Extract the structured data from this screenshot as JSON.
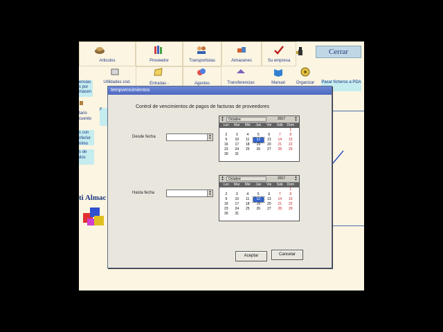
{
  "app": {
    "cerrar_label": "Cerrar",
    "top_row": [
      "Articulos",
      "Proveedor",
      "Transportistas",
      "Almacenes",
      "Su empresa"
    ],
    "second_row": [
      "Utilidades cod.",
      "Entradas -",
      "Agentes",
      "Transferencias",
      "Manual",
      "Organizar",
      "Pasar ficheros a PDA"
    ],
    "left_fragments": [
      "encias",
      "s por",
      "macen",
      "tario",
      "cuento",
      "s con",
      "nferior",
      "nimo",
      "s de",
      "dos"
    ],
    "small_fragment": "F",
    "brand_fragment": "ti Almac",
    "right_fragment": "a",
    "colors": {
      "background": "#fbf5e2",
      "cyan": "#c5ecef",
      "label": "#203a8a"
    }
  },
  "dialog": {
    "title": "tempvencimientos",
    "heading": "Control de vencimientos de pagos de facturas de proveedores",
    "desde_label": "Desde fecha",
    "hasta_label": "Hasta fecha",
    "accept_label": "Aceptar",
    "cancel_label": "Cancelar",
    "calendar_desde": {
      "month": "Octubre",
      "year": "2017",
      "weekdays": [
        "Lun",
        "Mar",
        "Mié",
        "Jue",
        "Vie",
        "Sáb",
        "Dom"
      ],
      "selected_day": 12,
      "first_weekday_index": 6,
      "days_in_month": 31
    },
    "calendar_hasta": {
      "month": "Octubre",
      "year": "2017",
      "weekdays": [
        "Lun",
        "Mar",
        "Mié",
        "Jue",
        "Vie",
        "Sáb",
        "Dom"
      ],
      "selected_day": 12,
      "first_weekday_index": 6,
      "days_in_month": 31
    }
  }
}
